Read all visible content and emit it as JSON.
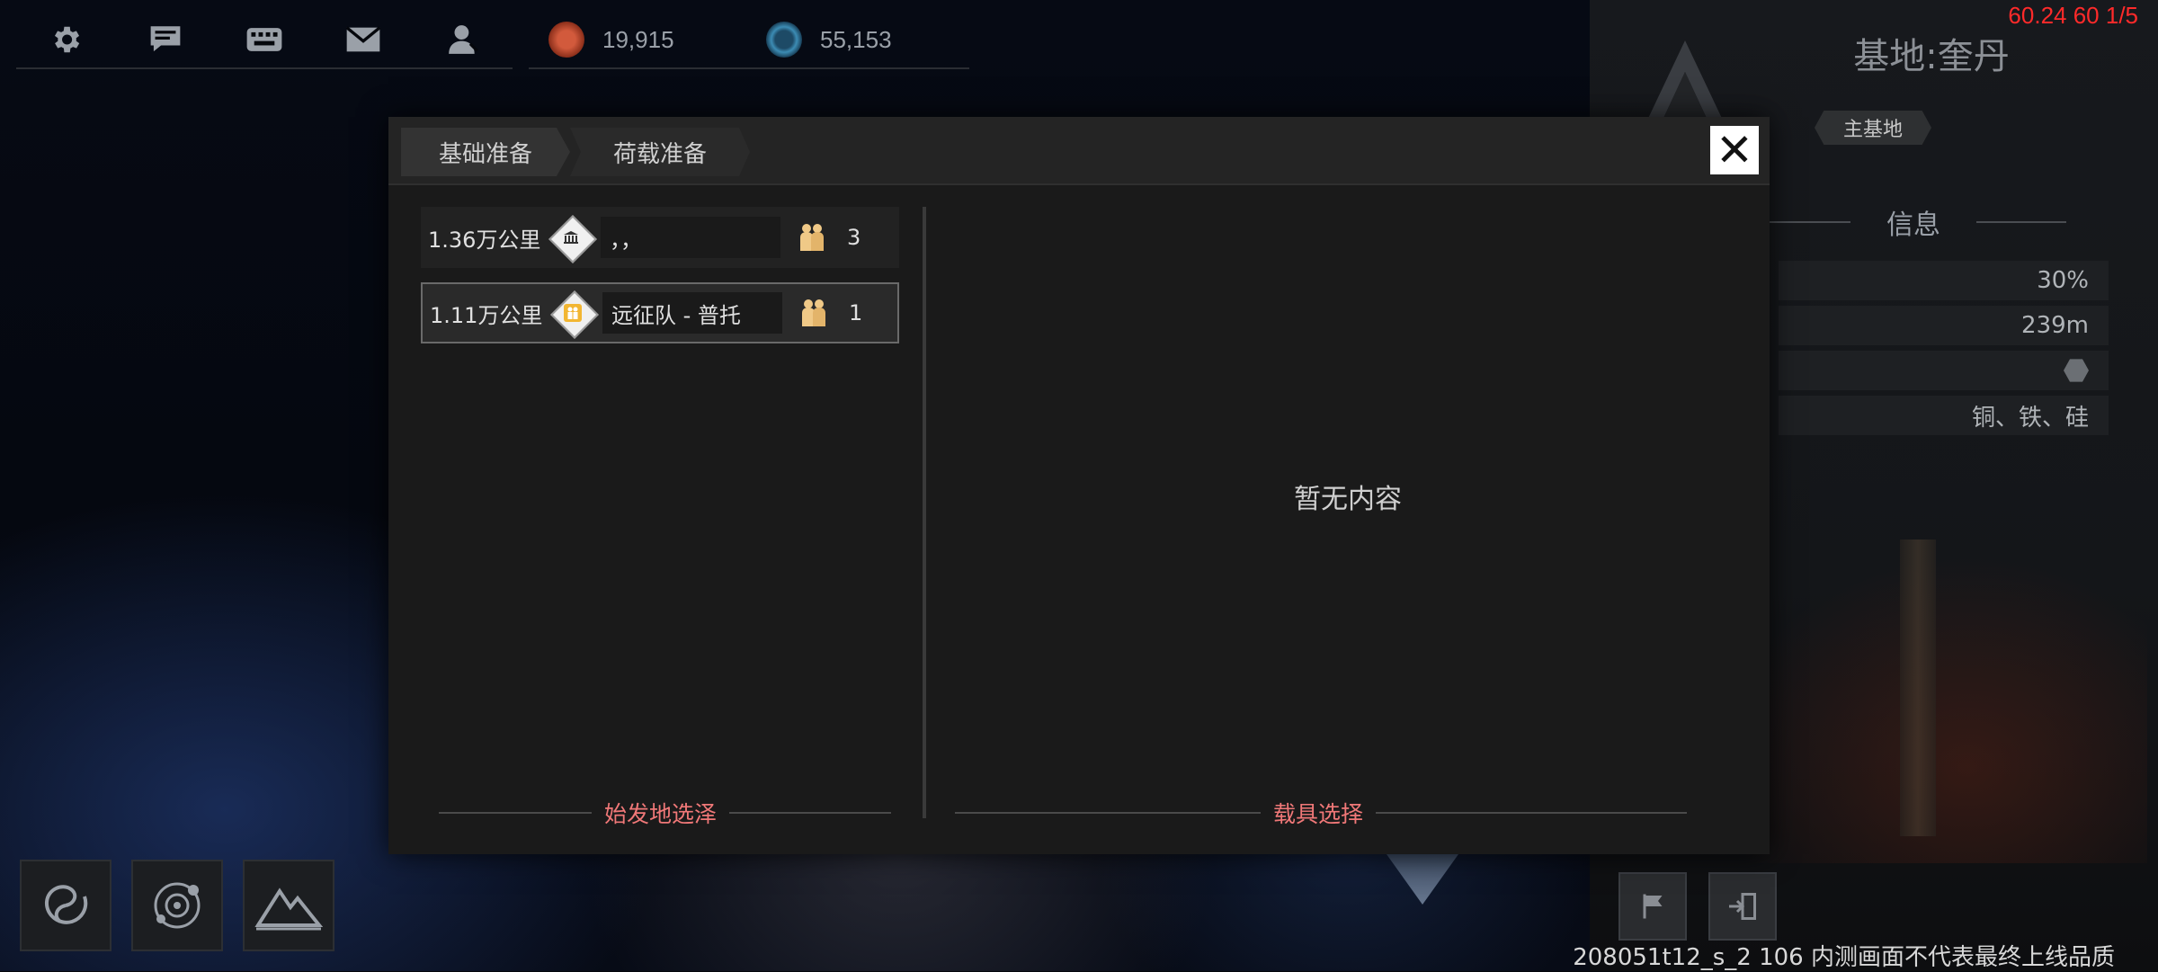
{
  "top_bar": {
    "icons": [
      "gear-icon",
      "chat-icon",
      "keyboard-icon",
      "mail-icon",
      "profile-icon"
    ],
    "resources": [
      {
        "name": "resource-red",
        "value": "19,915",
        "color": "#b4442c"
      },
      {
        "name": "resource-blue",
        "value": "55,153",
        "color": "#2c6b8c"
      }
    ]
  },
  "fps_text": "60.24 60 1/5",
  "right_panel": {
    "title": "基地:奎丹",
    "badge": "主基地",
    "section_label": "信息",
    "rows": [
      "30%",
      "239m",
      "",
      "铜、铁、硅"
    ]
  },
  "dialog": {
    "tabs": [
      "基础准备",
      "荷载准备"
    ],
    "close_symbol": "✕",
    "routes": [
      {
        "distance": "1.36万公里",
        "name": "，，",
        "count": "3",
        "selected": false
      },
      {
        "distance": "1.11万公里",
        "name": "远征队 - 普托",
        "count": "1",
        "selected": true
      }
    ],
    "empty_text": "暂无内容",
    "left_footer": "始发地选泽",
    "right_footer": "载具选择"
  },
  "watermark": "208051t12_s_2 106  内测画面不代表最终上线品质",
  "colors": {
    "accent_red": "#f07878",
    "people_icon": "#f0c987",
    "fps_red": "#ff2a2a"
  }
}
